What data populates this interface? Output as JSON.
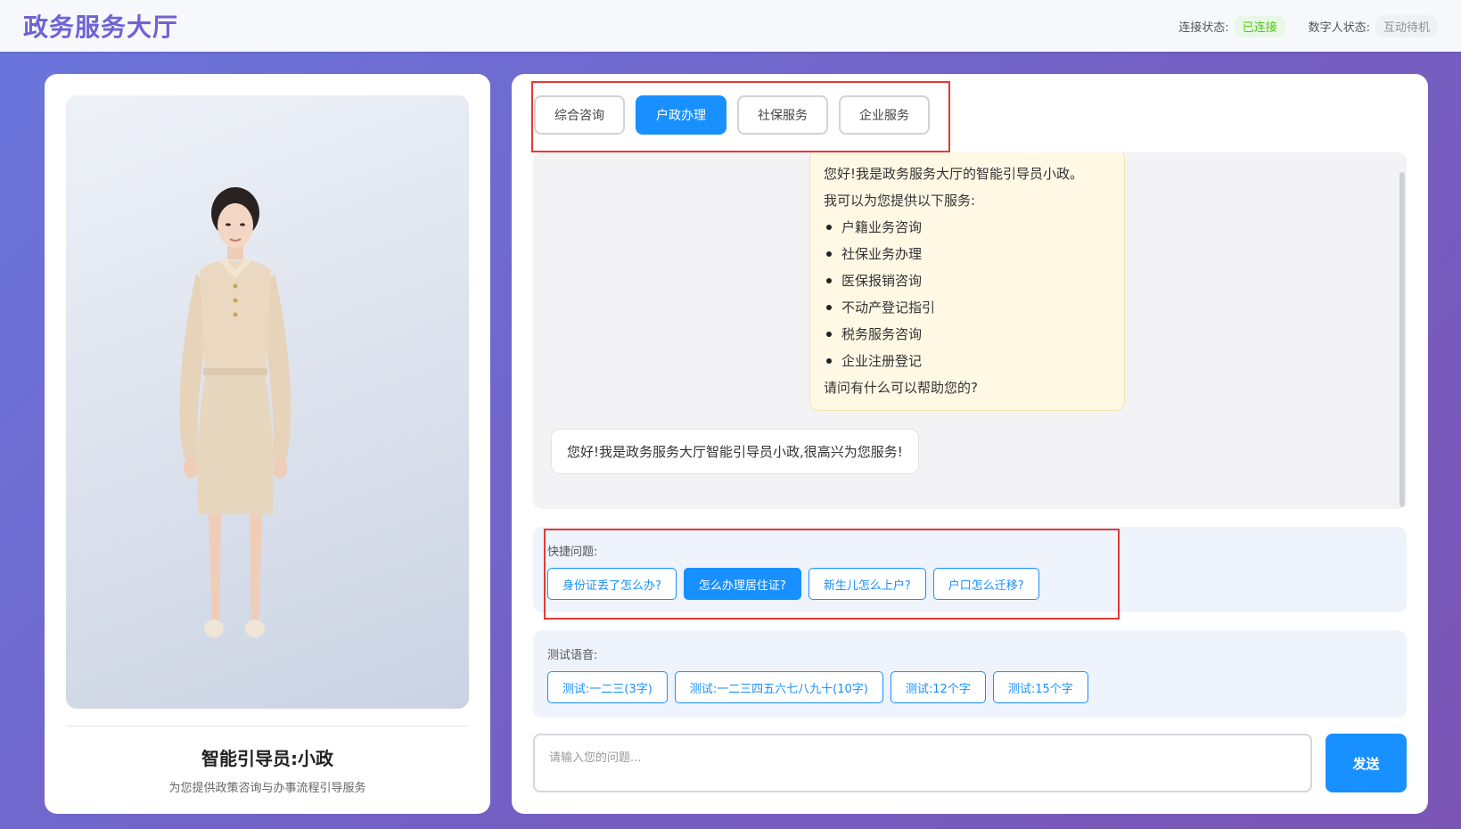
{
  "header": {
    "title": "政务服务大厅",
    "connection_label": "连接状态:",
    "connection_value": "已连接",
    "avatar_state_label": "数字人状态:",
    "avatar_state_value": "互动待机"
  },
  "colors": {
    "accent": "#1890ff",
    "title": "#6f63d4",
    "connected": "#52c41a",
    "highlight_box": "#e53935"
  },
  "left_panel": {
    "guide_name": "智能引导员:小政",
    "guide_description": "为您提供政策咨询与办事流程引导服务"
  },
  "tabs": [
    {
      "label": "综合咨询",
      "active": false
    },
    {
      "label": "户政办理",
      "active": true
    },
    {
      "label": "社保服务",
      "active": false
    },
    {
      "label": "企业服务",
      "active": false
    }
  ],
  "chat": {
    "bot_message": {
      "greeting": "您好!我是政务服务大厅的智能引导员小政。",
      "intro": "我可以为您提供以下服务:",
      "services": [
        "户籍业务咨询",
        "社保业务办理",
        "医保报销咨询",
        "不动产登记指引",
        "税务服务咨询",
        "企业注册登记"
      ],
      "closing": "请问有什么可以帮助您的?"
    },
    "user_message": "您好!我是政务服务大厅智能引导员小政,很高兴为您服务!"
  },
  "quick_questions": {
    "label": "快捷问题:",
    "items": [
      {
        "label": "身份证丢了怎么办?",
        "active": false
      },
      {
        "label": "怎么办理居住证?",
        "active": true
      },
      {
        "label": "新生儿怎么上户?",
        "active": false
      },
      {
        "label": "户口怎么迁移?",
        "active": false
      }
    ]
  },
  "voice_tests": {
    "label": "测试语音:",
    "items": [
      "测试:一二三(3字)",
      "测试:一二三四五六七八九十(10字)",
      "测试:12个字",
      "测试:15个字"
    ]
  },
  "input": {
    "placeholder": "请输入您的问题...",
    "send_label": "发送"
  }
}
